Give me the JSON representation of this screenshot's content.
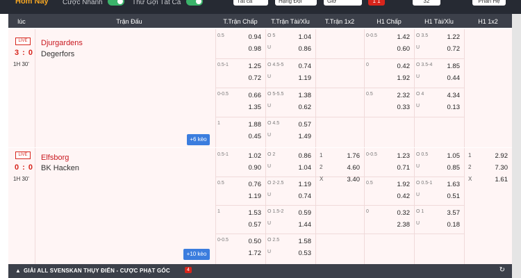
{
  "topbar": {
    "today": "Hôm Nay",
    "quick_bet_label": "Cược Nhanh",
    "show_all_label": "Thứ Gợi Tất Cả",
    "sort_label": "Tất cả",
    "league_select": "Hạng Đội",
    "time_select": "Giờ",
    "red_btn": "1 1",
    "btn2": "32",
    "btn3": "Phân Hệ"
  },
  "header": {
    "col_time": "lúc",
    "col_match": "Trận Đấu",
    "col_ft_hdp": "T.Trận Chấp",
    "col_ft_ou": "T.Trận Tài/Xỉu",
    "col_ft_1x2": "T.Trận 1x2",
    "col_h1_hdp": "H1 Chấp",
    "col_h1_ou": "H1 Tài/Xỉu",
    "col_h1_1x2": "H1 1x2"
  },
  "matches": [
    {
      "live": "LIVE",
      "score": "3 : 0",
      "time": "1H 30'",
      "home": "Djurgardens",
      "away": "Degerfors",
      "more": "+6 kèo",
      "rows": [
        {
          "ft_hdp": {
            "h": "0.5",
            "v1": "0.94",
            "v2": "0.98"
          },
          "ft_ou": {
            "h": "O 5",
            "h2": "U",
            "v1": "1.04",
            "v2": "0.86"
          },
          "h1_hdp": {
            "h": "0-0.5",
            "v1": "1.42",
            "v2": "0.60"
          },
          "h1_ou": {
            "h": "O 3.5",
            "h2": "U",
            "v1": "1.22",
            "v2": "0.72"
          }
        },
        {
          "ft_hdp": {
            "h": "0.5-1",
            "v1": "1.25",
            "v2": "0.72"
          },
          "ft_ou": {
            "h": "O 4.5-5",
            "h2": "U",
            "v1": "0.74",
            "v2": "1.19"
          },
          "h1_hdp": {
            "h": "0",
            "v1": "0.42",
            "v2": "1.92"
          },
          "h1_ou": {
            "h": "O 3.5-4",
            "h2": "U",
            "v1": "1.85",
            "v2": "0.44"
          }
        },
        {
          "ft_hdp": {
            "h": "0-0.5",
            "v1": "0.66",
            "v2": "1.35"
          },
          "ft_ou": {
            "h": "O 5-5.5",
            "h2": "U",
            "v1": "1.38",
            "v2": "0.62"
          },
          "h1_hdp": {
            "h": "0.5",
            "v1": "2.32",
            "v2": "0.33"
          },
          "h1_ou": {
            "h": "O 4",
            "h2": "U",
            "v1": "4.34",
            "v2": "0.13"
          }
        },
        {
          "ft_hdp": {
            "h": "1",
            "v1": "1.88",
            "v2": "0.45"
          },
          "ft_ou": {
            "h": "O 4.5",
            "h2": "U",
            "v1": "0.57",
            "v2": "1.49"
          },
          "h1_hdp": {
            "h": "",
            "v1": "",
            "v2": ""
          },
          "h1_ou": {
            "h": "",
            "h2": "",
            "v1": "",
            "v2": ""
          }
        }
      ]
    },
    {
      "live": "LIVE",
      "score": "0 : 0",
      "time": "1H 30'",
      "home": "Elfsborg",
      "away": "BK Hacken",
      "more": "+10 kèo",
      "ft_1x2": [
        {
          "k": "1",
          "v": "1.76"
        },
        {
          "k": "2",
          "v": "4.60"
        },
        {
          "k": "X",
          "v": "3.40"
        }
      ],
      "h1_1x2": [
        {
          "k": "1",
          "v": "2.92"
        },
        {
          "k": "2",
          "v": "7.30"
        },
        {
          "k": "X",
          "v": "1.61"
        }
      ],
      "rows": [
        {
          "ft_hdp": {
            "h": "0.5-1",
            "v1": "1.02",
            "v2": "0.90"
          },
          "ft_ou": {
            "h": "O 2",
            "h2": "U",
            "v1": "0.86",
            "v2": "1.04"
          },
          "h1_hdp": {
            "h": "0-0.5",
            "v1": "1.23",
            "v2": "0.71"
          },
          "h1_ou": {
            "h": "O 0.5",
            "h2": "U",
            "v1": "1.05",
            "v2": "0.85"
          }
        },
        {
          "ft_hdp": {
            "h": "0.5",
            "v1": "0.76",
            "v2": "1.19"
          },
          "ft_ou": {
            "h": "O 2-2.5",
            "h2": "U",
            "v1": "1.19",
            "v2": "0.74"
          },
          "h1_hdp": {
            "h": "0.5",
            "v1": "1.92",
            "v2": "0.42"
          },
          "h1_ou": {
            "h": "O 0.5-1",
            "h2": "U",
            "v1": "1.63",
            "v2": "0.51"
          }
        },
        {
          "ft_hdp": {
            "h": "1",
            "v1": "1.53",
            "v2": "0.57"
          },
          "ft_ou": {
            "h": "O 1.5-2",
            "h2": "U",
            "v1": "0.59",
            "v2": "1.44"
          },
          "h1_hdp": {
            "h": "0",
            "v1": "0.32",
            "v2": "2.38"
          },
          "h1_ou": {
            "h": "O 1",
            "h2": "U",
            "v1": "3.57",
            "v2": "0.18"
          }
        },
        {
          "ft_hdp": {
            "h": "0-0.5",
            "v1": "0.50",
            "v2": "1.72"
          },
          "ft_ou": {
            "h": "O 2.5",
            "h2": "U",
            "v1": "1.58",
            "v2": "0.53"
          },
          "h1_hdp": {
            "h": "",
            "v1": "",
            "v2": ""
          },
          "h1_ou": {
            "h": "",
            "h2": "",
            "v1": "",
            "v2": ""
          }
        }
      ]
    }
  ],
  "league_bar": {
    "name": "GIẢI ALL SVENSKAN THỤY ĐIỂN - CƯỢC PHẠT GÓC",
    "count": "4",
    "chevron_icon": "chevron-up-icon",
    "refresh_icon": "refresh-icon"
  }
}
